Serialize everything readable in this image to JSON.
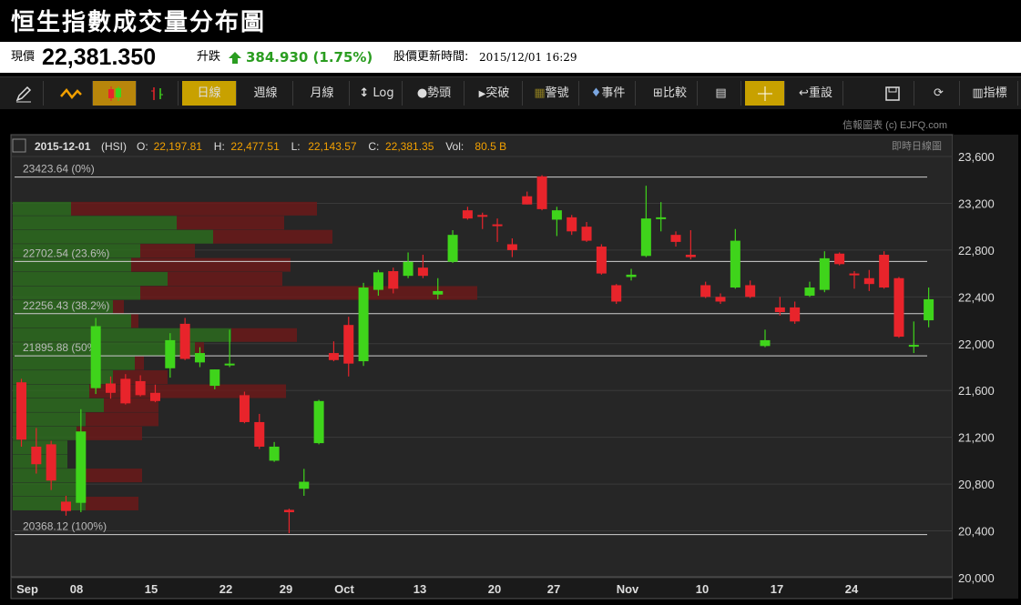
{
  "title": "恒生指數成交量分布圖",
  "quote": {
    "now_label": "現價",
    "price": "22,381.350",
    "change_label": "升跌",
    "change": "384.930 (1.75%)",
    "update_label": "股價更新時間:",
    "update_time": "2015/12/01 16:29"
  },
  "toolbar": {
    "day": "日線",
    "week": "週線",
    "month": "月線",
    "log": "Log",
    "trend": "勢頭",
    "breakout": "突破",
    "warning": "警號",
    "event": "事件",
    "compare": "比較",
    "reset": "重設",
    "indicator": "指標"
  },
  "colors": {
    "up": "#3fd41b",
    "down": "#e8242b",
    "accent": "#c8a100",
    "vol_green": "#2d6b1e",
    "vol_red": "#6b1a1a",
    "background": "#262626"
  },
  "chart_header": {
    "date": "2015-12-01",
    "symbol": "(HSI)",
    "o_label": "O:",
    "o": "22,197.81",
    "h_label": "H:",
    "h": "22,477.51",
    "l_label": "L:",
    "l": "22,143.57",
    "c_label": "C:",
    "c": "22,381.35",
    "vol_label": "Vol:",
    "vol": "80.5 B",
    "credit": "信報圖表 (c) EJFQ.com",
    "mode": "即時日線圖"
  },
  "chart_data": {
    "type": "candlestick",
    "ylim": [
      20000,
      23600
    ],
    "y_ticks": [
      "23,600",
      "23,200",
      "22,800",
      "22,400",
      "22,000",
      "21,600",
      "21,200",
      "20,800",
      "20,400",
      "20,000"
    ],
    "x_labels": [
      "Sep",
      "08",
      "15",
      "22",
      "29",
      "Oct",
      "13",
      "20",
      "27",
      "Nov",
      "10",
      "17",
      "24"
    ],
    "fib_levels": [
      {
        "value": 23423.64,
        "label": "23423.64 (0%)"
      },
      {
        "value": 22702.54,
        "label": "22702.54 (23.6%)"
      },
      {
        "value": 22256.43,
        "label": "22256.43 (38.2%)"
      },
      {
        "value": 21895.88,
        "label": "21895.88 (50%)"
      },
      {
        "value": 20368.12,
        "label": "20368.12 (100%)"
      }
    ],
    "candles": [
      {
        "o": 21670,
        "h": 21700,
        "l": 21120,
        "c": 21180
      },
      {
        "o": 21120,
        "h": 21280,
        "l": 20890,
        "c": 20970
      },
      {
        "o": 21140,
        "h": 21170,
        "l": 20750,
        "c": 20830
      },
      {
        "o": 20650,
        "h": 20700,
        "l": 20530,
        "c": 20570
      },
      {
        "o": 20640,
        "h": 21440,
        "l": 20560,
        "c": 21250
      },
      {
        "o": 21620,
        "h": 22220,
        "l": 21570,
        "c": 22150
      },
      {
        "o": 21660,
        "h": 21720,
        "l": 21530,
        "c": 21580
      },
      {
        "o": 21700,
        "h": 21740,
        "l": 21480,
        "c": 21490
      },
      {
        "o": 21680,
        "h": 21730,
        "l": 21550,
        "c": 21560
      },
      {
        "o": 21580,
        "h": 21650,
        "l": 21500,
        "c": 21510
      },
      {
        "o": 21790,
        "h": 22090,
        "l": 21710,
        "c": 22030
      },
      {
        "o": 22170,
        "h": 22220,
        "l": 21860,
        "c": 21870
      },
      {
        "o": 21840,
        "h": 21970,
        "l": 21800,
        "c": 21920
      },
      {
        "o": 21640,
        "h": 21780,
        "l": 21610,
        "c": 21780
      },
      {
        "o": 21830,
        "h": 22120,
        "l": 21800,
        "c": 21830
      },
      {
        "o": 21560,
        "h": 21590,
        "l": 21320,
        "c": 21330
      },
      {
        "o": 21330,
        "h": 21400,
        "l": 21100,
        "c": 21120
      },
      {
        "o": 21000,
        "h": 21160,
        "l": 20990,
        "c": 21120
      },
      {
        "o": 20580,
        "h": 20590,
        "l": 20380,
        "c": 20560
      },
      {
        "o": 20760,
        "h": 20930,
        "l": 20700,
        "c": 20820
      },
      {
        "o": 21150,
        "h": 21520,
        "l": 21140,
        "c": 21510
      },
      {
        "o": 21920,
        "h": 22020,
        "l": 21850,
        "c": 21860
      },
      {
        "o": 22160,
        "h": 22230,
        "l": 21720,
        "c": 21830
      },
      {
        "o": 21850,
        "h": 22520,
        "l": 21810,
        "c": 22480
      },
      {
        "o": 22460,
        "h": 22630,
        "l": 22410,
        "c": 22610
      },
      {
        "o": 22620,
        "h": 22650,
        "l": 22430,
        "c": 22470
      },
      {
        "o": 22580,
        "h": 22780,
        "l": 22560,
        "c": 22700
      },
      {
        "o": 22650,
        "h": 22760,
        "l": 22560,
        "c": 22580
      },
      {
        "o": 22420,
        "h": 22560,
        "l": 22380,
        "c": 22450
      },
      {
        "o": 22700,
        "h": 22970,
        "l": 22690,
        "c": 22930
      },
      {
        "o": 23140,
        "h": 23170,
        "l": 23060,
        "c": 23070
      },
      {
        "o": 23100,
        "h": 23120,
        "l": 22980,
        "c": 23090
      },
      {
        "o": 23020,
        "h": 23070,
        "l": 22870,
        "c": 23010
      },
      {
        "o": 22850,
        "h": 22900,
        "l": 22740,
        "c": 22800
      },
      {
        "o": 23260,
        "h": 23300,
        "l": 23190,
        "c": 23190
      },
      {
        "o": 23430,
        "h": 23440,
        "l": 23140,
        "c": 23150
      },
      {
        "o": 23060,
        "h": 23170,
        "l": 22920,
        "c": 23140
      },
      {
        "o": 23080,
        "h": 23100,
        "l": 22930,
        "c": 22960
      },
      {
        "o": 23000,
        "h": 23040,
        "l": 22870,
        "c": 22880
      },
      {
        "o": 22830,
        "h": 22850,
        "l": 22590,
        "c": 22600
      },
      {
        "o": 22500,
        "h": 22510,
        "l": 22340,
        "c": 22360
      },
      {
        "o": 22570,
        "h": 22640,
        "l": 22540,
        "c": 22590
      },
      {
        "o": 22750,
        "h": 23350,
        "l": 22740,
        "c": 23070
      },
      {
        "o": 23070,
        "h": 23210,
        "l": 22960,
        "c": 23080
      },
      {
        "o": 22930,
        "h": 22960,
        "l": 22830,
        "c": 22870
      },
      {
        "o": 22760,
        "h": 22970,
        "l": 22720,
        "c": 22740
      },
      {
        "o": 22500,
        "h": 22530,
        "l": 22390,
        "c": 22400
      },
      {
        "o": 22400,
        "h": 22430,
        "l": 22340,
        "c": 22360
      },
      {
        "o": 22480,
        "h": 22980,
        "l": 22470,
        "c": 22880
      },
      {
        "o": 22500,
        "h": 22540,
        "l": 22390,
        "c": 22400
      },
      {
        "o": 21980,
        "h": 22120,
        "l": 21970,
        "c": 22030
      },
      {
        "o": 22310,
        "h": 22400,
        "l": 22240,
        "c": 22270
      },
      {
        "o": 22310,
        "h": 22360,
        "l": 22170,
        "c": 22190
      },
      {
        "o": 22410,
        "h": 22530,
        "l": 22400,
        "c": 22480
      },
      {
        "o": 22460,
        "h": 22790,
        "l": 22440,
        "c": 22730
      },
      {
        "o": 22770,
        "h": 22780,
        "l": 22670,
        "c": 22680
      },
      {
        "o": 22600,
        "h": 22620,
        "l": 22470,
        "c": 22590
      },
      {
        "o": 22560,
        "h": 22630,
        "l": 22450,
        "c": 22510
      },
      {
        "o": 22760,
        "h": 22790,
        "l": 22470,
        "c": 22480
      },
      {
        "o": 22560,
        "h": 22570,
        "l": 22050,
        "c": 22060
      },
      {
        "o": 21980,
        "h": 22190,
        "l": 21920,
        "c": 21990
      },
      {
        "o": 22200,
        "h": 22480,
        "l": 22140,
        "c": 22380
      }
    ],
    "volume_profile": [
      {
        "price": 23150,
        "up": 64,
        "down": 270
      },
      {
        "price": 23030,
        "up": 180,
        "down": 118
      },
      {
        "price": 22910,
        "up": 220,
        "down": 131
      },
      {
        "price": 22790,
        "up": 140,
        "down": 60
      },
      {
        "price": 22670,
        "up": 130,
        "down": 175
      },
      {
        "price": 22550,
        "up": 170,
        "down": 126
      },
      {
        "price": 22430,
        "up": 140,
        "down": 370
      },
      {
        "price": 22310,
        "up": 110,
        "down": 12
      },
      {
        "price": 22190,
        "up": 130,
        "down": 8
      },
      {
        "price": 22070,
        "up": 240,
        "down": 72
      },
      {
        "price": 21950,
        "up": 200,
        "down": 10
      },
      {
        "price": 21830,
        "up": 134,
        "down": 10
      },
      {
        "price": 21710,
        "up": 110,
        "down": 60
      },
      {
        "price": 21590,
        "up": 84,
        "down": 216
      },
      {
        "price": 21470,
        "up": 100,
        "down": 60
      },
      {
        "price": 21350,
        "up": 80,
        "down": 80
      },
      {
        "price": 21230,
        "up": 70,
        "down": 72
      },
      {
        "price": 21110,
        "up": 60,
        "down": 0
      },
      {
        "price": 20990,
        "up": 60,
        "down": 0
      },
      {
        "price": 20870,
        "up": 70,
        "down": 72
      },
      {
        "price": 20750,
        "up": 80,
        "down": 0
      },
      {
        "price": 20630,
        "up": 80,
        "down": 58
      }
    ]
  }
}
